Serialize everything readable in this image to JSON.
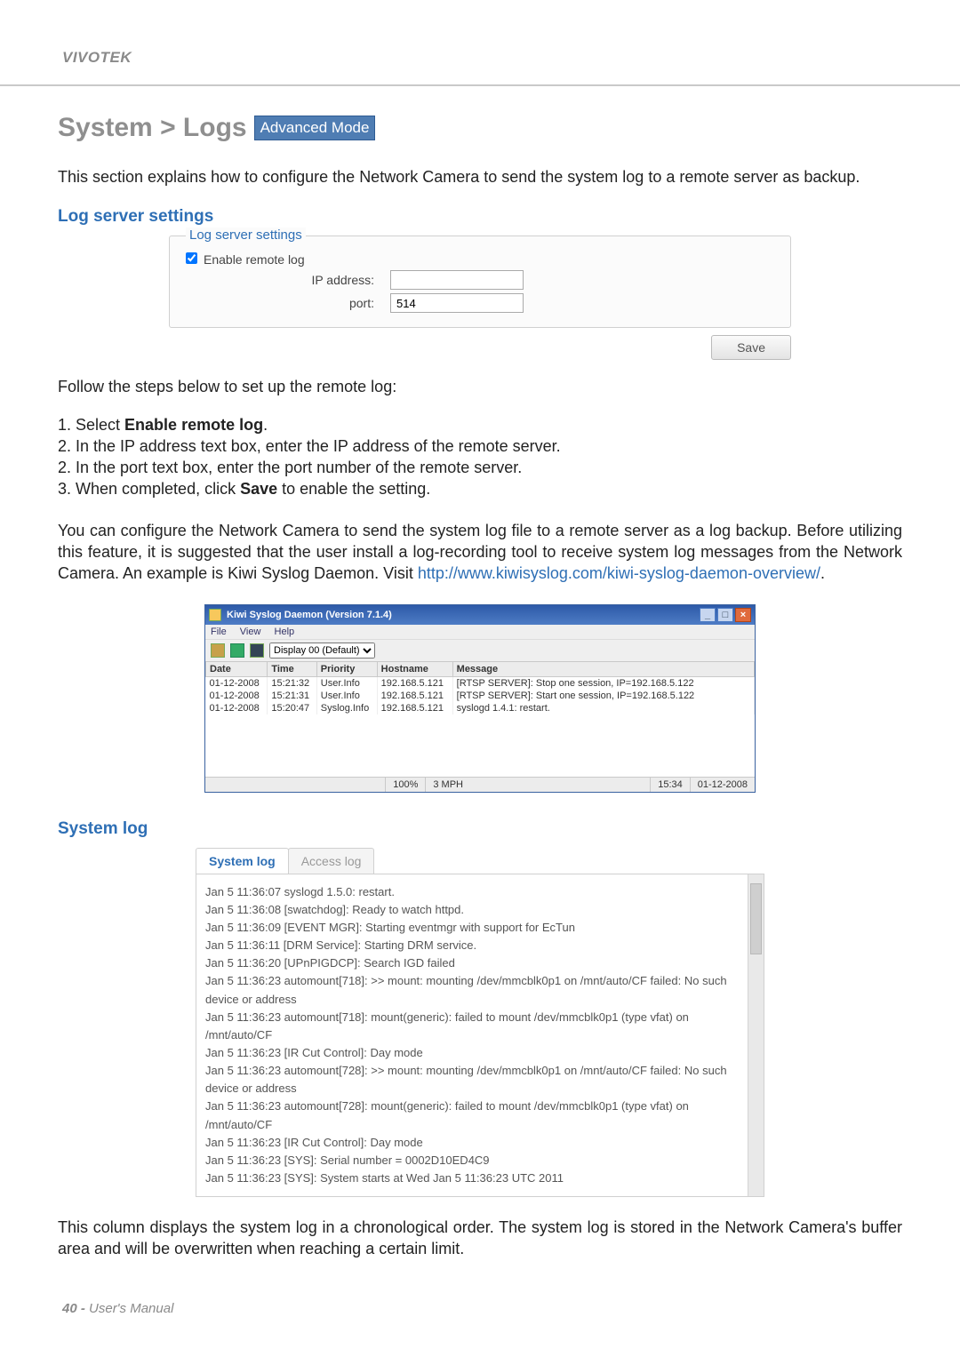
{
  "brand": "VIVOTEK",
  "title_prefix": "System > Logs",
  "adv_mode": "Advanced Mode",
  "intro": "This section explains how to configure the Network Camera to send the system log to a remote server as backup.",
  "log_server_heading": "Log server settings",
  "settings": {
    "legend": "Log server settings",
    "enable_label": "Enable remote log",
    "ip_label": "IP address:",
    "ip_value": "",
    "port_label": "port:",
    "port_value": "514",
    "save": "Save"
  },
  "follow_intro": "Follow the steps below to set up the remote log:",
  "steps": [
    "1. Select ",
    "Enable remote log",
    ".",
    "2. In the IP address text box, enter the IP address of the remote server.",
    "2. In the port text box, enter the port number of the remote server.",
    "3. When completed, click ",
    "Save",
    " to enable the setting."
  ],
  "backup_para_1": "You can configure the Network Camera to send the system log file to a remote server as a log backup. Before utilizing this feature, it is suggested that the user install a log-recording tool to receive system log messages from the Network Camera. An example is Kiwi Syslog Daemon. Visit ",
  "backup_link": "http://www.kiwisyslog.com/kiwi-syslog-daemon-overview/",
  "backup_para_2": ".",
  "kiwi": {
    "title": "Kiwi Syslog Daemon (Version 7.1.4)",
    "menu": [
      "File",
      "View",
      "Help"
    ],
    "display_label": "Display 00 (Default)",
    "columns": [
      "Date",
      "Time",
      "Priority",
      "Hostname",
      "Message"
    ],
    "rows": [
      {
        "date": "01-12-2008",
        "time": "15:21:32",
        "priority": "User.Info",
        "host": "192.168.5.121",
        "msg": "[RTSP SERVER]: Stop one session, IP=192.168.5.122"
      },
      {
        "date": "01-12-2008",
        "time": "15:21:31",
        "priority": "User.Info",
        "host": "192.168.5.121",
        "msg": "[RTSP SERVER]: Start one session, IP=192.168.5.122"
      },
      {
        "date": "01-12-2008",
        "time": "15:20:47",
        "priority": "Syslog.Info",
        "host": "192.168.5.121",
        "msg": "syslogd 1.4.1: restart."
      }
    ],
    "status_pct": "100%",
    "status_mph": "3 MPH",
    "status_time": "15:34",
    "status_date": "01-12-2008"
  },
  "system_log_heading": "System log",
  "tabs": {
    "active": "System log",
    "other": "Access log"
  },
  "log_entries": [
    "Jan 5 11:36:07 syslogd 1.5.0: restart.",
    "Jan 5 11:36:08 [swatchdog]: Ready to watch httpd.",
    "Jan 5 11:36:09 [EVENT MGR]: Starting eventmgr with support for EcTun",
    "Jan 5 11:36:11 [DRM Service]: Starting DRM service.",
    "Jan 5 11:36:20 [UPnPIGDCP]: Search IGD failed",
    "Jan 5 11:36:23 automount[718]: >> mount: mounting /dev/mmcblk0p1 on /mnt/auto/CF failed: No such device or address",
    "Jan 5 11:36:23 automount[718]: mount(generic): failed to mount /dev/mmcblk0p1 (type vfat) on /mnt/auto/CF",
    "Jan 5 11:36:23 [IR Cut Control]: Day mode",
    "Jan 5 11:36:23 automount[728]: >> mount: mounting /dev/mmcblk0p1 on /mnt/auto/CF failed: No such device or address",
    "Jan 5 11:36:23 automount[728]: mount(generic): failed to mount /dev/mmcblk0p1 (type vfat) on /mnt/auto/CF",
    "Jan 5 11:36:23 [IR Cut Control]: Day mode",
    "Jan 5 11:36:23 [SYS]: Serial number = 0002D10ED4C9",
    "Jan 5 11:36:23 [SYS]: System starts at Wed Jan 5 11:36:23 UTC 2011"
  ],
  "outro_para": "This column displays the system log in a chronological order. The system log is stored in the Network Camera's buffer area and will be overwritten when reaching a certain limit.",
  "page_num_prefix": "40 - ",
  "page_num_label": "User's Manual"
}
